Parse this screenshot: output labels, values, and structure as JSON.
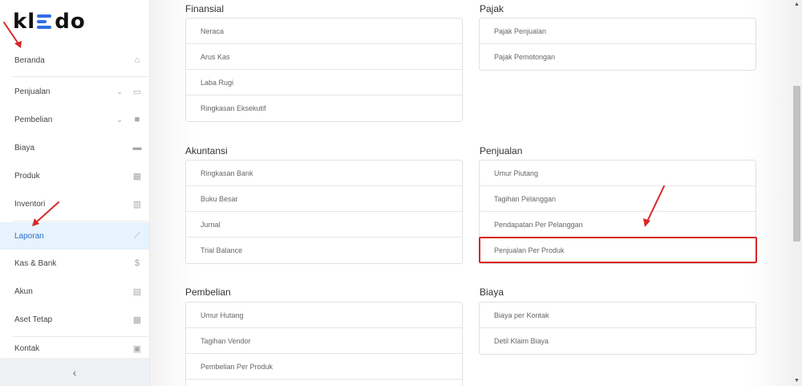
{
  "logo": {
    "left": "kl",
    "right": "do"
  },
  "sidebar": {
    "items": [
      {
        "label": "Beranda",
        "icon": "home-icon",
        "glyph": "⌂"
      },
      {
        "label": "Penjualan",
        "icon": "shopping-basket-icon",
        "glyph": "▭"
      },
      {
        "label": "Pembelian",
        "icon": "shopping-bag-icon",
        "glyph": "■"
      },
      {
        "label": "Biaya",
        "icon": "credit-card-icon",
        "glyph": "▬"
      },
      {
        "label": "Produk",
        "icon": "boxes-icon",
        "glyph": "▦"
      },
      {
        "label": "Inventori",
        "icon": "warehouse-icon",
        "glyph": "▥"
      },
      {
        "label": "Laporan",
        "icon": "line-chart-icon",
        "glyph": "⟋"
      },
      {
        "label": "Kas & Bank",
        "icon": "dollar-icon",
        "glyph": "$"
      },
      {
        "label": "Akun",
        "icon": "ledger-icon",
        "glyph": "▤"
      },
      {
        "label": "Aset Tetap",
        "icon": "building-icon",
        "glyph": "▦"
      },
      {
        "label": "Kontak",
        "icon": "contact-card-icon",
        "glyph": "▣"
      }
    ],
    "collapse_glyph": "‹"
  },
  "sections": {
    "finansial": {
      "title": "Finansial",
      "items": [
        "Neraca",
        "Arus Kas",
        "Laba Rugi",
        "Ringkasan Eksekutif"
      ]
    },
    "pajak": {
      "title": "Pajak",
      "items": [
        "Pajak Penjualan",
        "Pajak Pemotongan"
      ]
    },
    "akuntansi": {
      "title": "Akuntansi",
      "items": [
        "Ringkasan Bank",
        "Buku Besar",
        "Jurnal",
        "Trial Balance"
      ]
    },
    "penjualan": {
      "title": "Penjualan",
      "items": [
        "Umur Piutang",
        "Tagihan Pelanggan",
        "Pendapatan Per Pelanggan",
        "Penjualan Per Produk"
      ]
    },
    "pembelian": {
      "title": "Pembelian",
      "items": [
        "Umur Hutang",
        "Tagihan Vendor",
        "Pembelian Per Produk"
      ]
    },
    "biaya": {
      "title": "Biaya",
      "items": [
        "Biaya per Kontak",
        "Detil Klaim Biaya"
      ]
    }
  },
  "colors": {
    "accent": "#2f6fe4",
    "active_bg": "#e6f2fd",
    "highlight": "#d62828"
  }
}
